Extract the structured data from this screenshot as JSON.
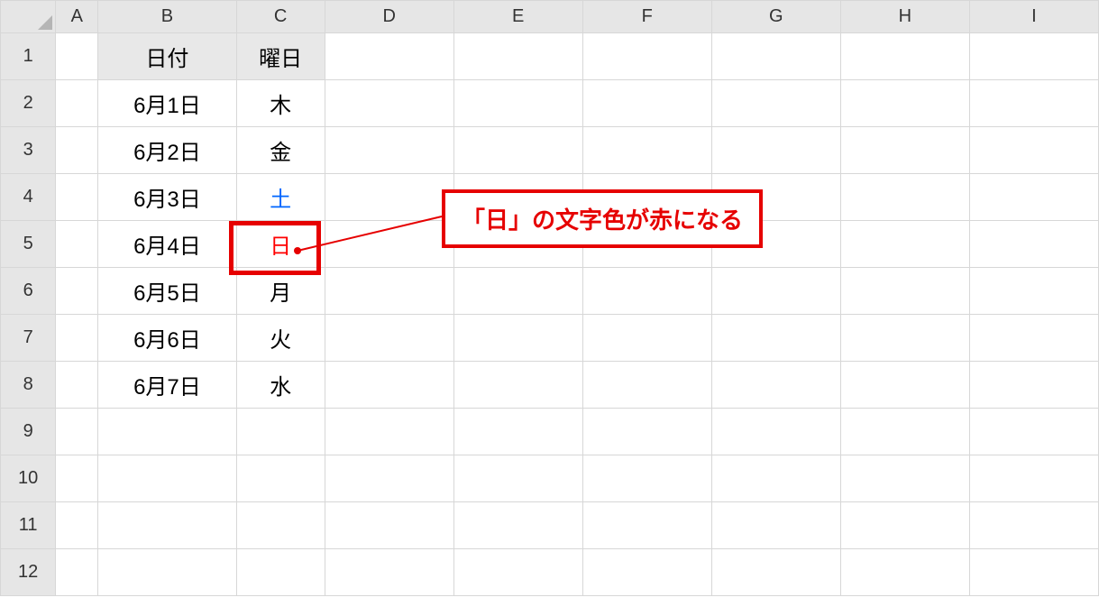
{
  "columns": [
    "A",
    "B",
    "C",
    "D",
    "E",
    "F",
    "G",
    "H",
    "I"
  ],
  "rows": [
    "1",
    "2",
    "3",
    "4",
    "5",
    "6",
    "7",
    "8",
    "9",
    "10",
    "11",
    "12"
  ],
  "table": {
    "headers": {
      "date": "日付",
      "weekday": "曜日"
    },
    "data": [
      {
        "date": "6月1日",
        "weekday": "木",
        "style": ""
      },
      {
        "date": "6月2日",
        "weekday": "金",
        "style": ""
      },
      {
        "date": "6月3日",
        "weekday": "土",
        "style": "sat"
      },
      {
        "date": "6月4日",
        "weekday": "日",
        "style": "sun"
      },
      {
        "date": "6月5日",
        "weekday": "月",
        "style": ""
      },
      {
        "date": "6月6日",
        "weekday": "火",
        "style": ""
      },
      {
        "date": "6月7日",
        "weekday": "水",
        "style": ""
      }
    ]
  },
  "callout": {
    "text": "「日」の文字色が赤になる"
  },
  "colors": {
    "accent_red": "#e60000",
    "sat_blue": "#0066ff",
    "sun_red": "#ff0000"
  }
}
